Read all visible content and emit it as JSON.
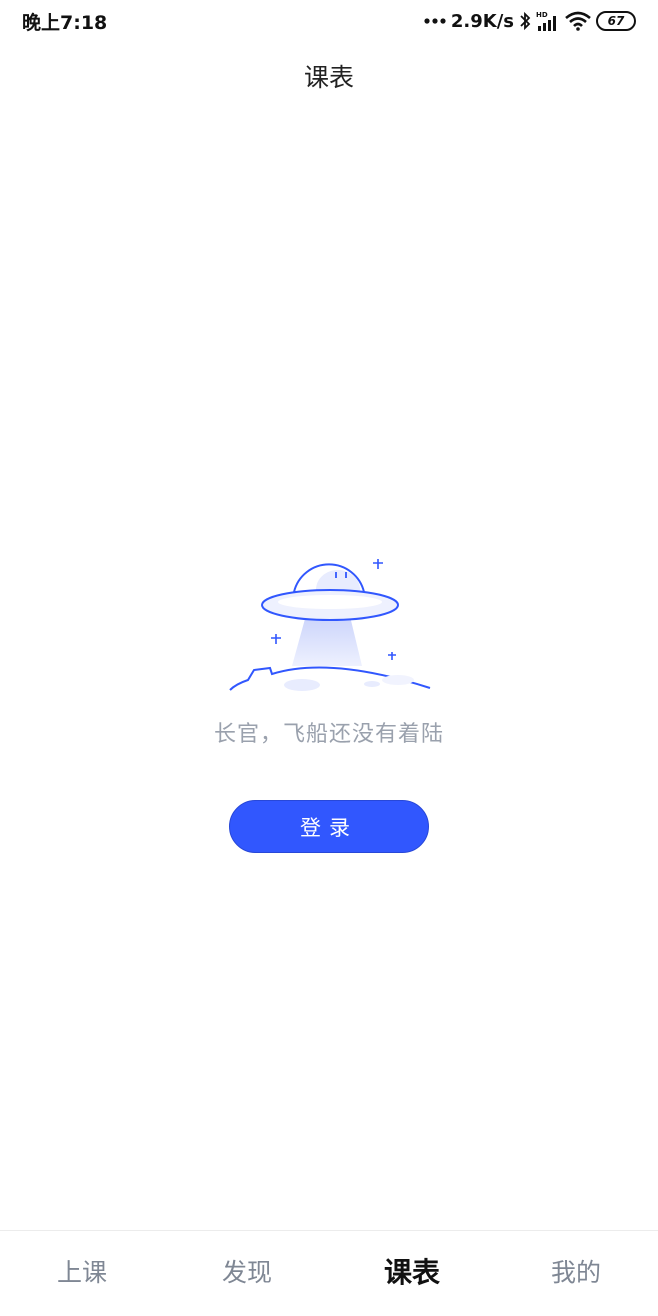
{
  "status_bar": {
    "time": "晚上7:18",
    "net_speed": "2.9K/s",
    "battery_level": "67",
    "icons": [
      "dots-icon",
      "bluetooth-icon",
      "hd-signal-icon",
      "wifi-icon",
      "battery-icon"
    ]
  },
  "header": {
    "title": "课表"
  },
  "empty_state": {
    "illustration": "ufo-landing-illustration",
    "message": "长官，飞船还没有着陆"
  },
  "login_button": {
    "label": "登录"
  },
  "tab_bar": {
    "items": [
      {
        "label": "上课",
        "active": false
      },
      {
        "label": "发现",
        "active": false
      },
      {
        "label": "课表",
        "active": true
      },
      {
        "label": "我的",
        "active": false
      }
    ]
  },
  "colors": {
    "accent": "#3157fe",
    "muted_text": "#9aa1ad",
    "active_tab_indicator": "#cdd6fb"
  }
}
